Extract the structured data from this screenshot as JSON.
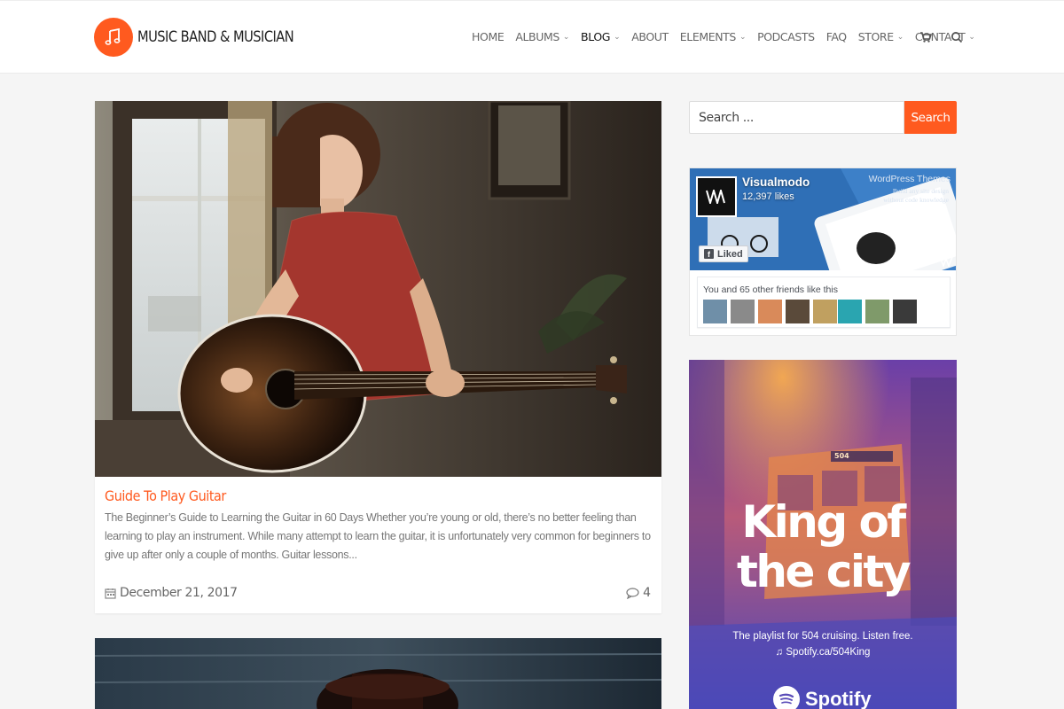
{
  "header": {
    "logo_text": "MUSIC BAND & MUSICIAN",
    "nav": [
      {
        "label": "HOME",
        "dropdown": false
      },
      {
        "label": "ALBUMS",
        "dropdown": true
      },
      {
        "label": "BLOG",
        "dropdown": true,
        "active": true
      },
      {
        "label": "ABOUT",
        "dropdown": false
      },
      {
        "label": "ELEMENTS",
        "dropdown": true
      },
      {
        "label": "PODCASTS",
        "dropdown": false
      },
      {
        "label": "FAQ",
        "dropdown": false
      },
      {
        "label": "STORE",
        "dropdown": true
      },
      {
        "label": "CONTACT",
        "dropdown": true
      }
    ],
    "icons": [
      "cart-icon",
      "search-icon"
    ]
  },
  "post": {
    "title": "Guide To Play Guitar",
    "excerpt": "The Beginner’s Guide to Learning the Guitar in 60 Days Whether you’re young or old, there’s no better feeling than learning to play an instrument. While many attempt to learn the guitar, it is unfortunately very common for beginners to give up after only a couple of months. Guitar lessons...",
    "date": "December 21, 2017",
    "comments": "4"
  },
  "sidebar": {
    "search": {
      "placeholder": "Search ...",
      "button": "Search"
    },
    "facebook": {
      "page_name": "Visualmodo",
      "likes": "12,397 likes",
      "cover_text": "WordPress Themes",
      "cover_small_1": "Build any site design",
      "cover_small_2": "without code knowledge",
      "liked_label": "Liked",
      "friends_text": "You and 65 other friends like this"
    },
    "ad": {
      "headline_1": "King of",
      "headline_2": "the city",
      "sub": "The playlist for 504 cruising. Listen free.",
      "link": "♫ Spotify.ca/504King",
      "brand": "Spotify",
      "bus_sign": "504"
    }
  },
  "colors": {
    "accent": "#ff5a1f",
    "header_bg": "#ffffff",
    "page_bg": "#f5f5f5"
  }
}
